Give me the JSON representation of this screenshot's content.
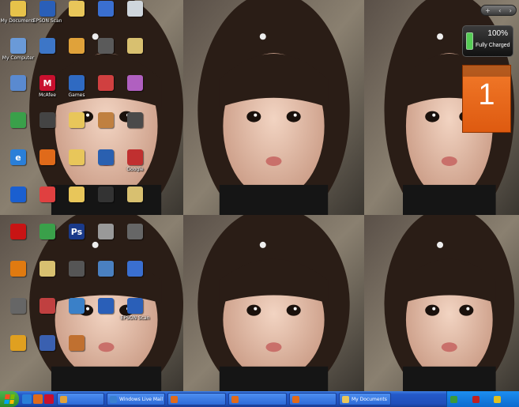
{
  "desktop": {
    "icons": [
      {
        "name": "my-documents-icon",
        "label": "My Documents",
        "glyph": "",
        "color": "#e7c24a"
      },
      {
        "name": "epson-scan-icon",
        "label": "EPSON Scan",
        "glyph": "",
        "color": "#2a5fb8"
      },
      {
        "name": "folder-icon",
        "label": "",
        "glyph": "",
        "color": "#e8c65a"
      },
      {
        "name": "app-icon",
        "label": "",
        "glyph": "",
        "color": "#3a6fd0"
      },
      {
        "name": "recycle-bin-icon",
        "label": "",
        "glyph": "",
        "color": "#cfd6dc"
      },
      {
        "name": "my-computer-icon",
        "label": "My Computer",
        "glyph": "",
        "color": "#6a9ad8"
      },
      {
        "name": "app-icon",
        "label": "",
        "glyph": "",
        "color": "#3d76c7"
      },
      {
        "name": "app-icon",
        "label": "",
        "glyph": "",
        "color": "#e0a23a"
      },
      {
        "name": "app-icon",
        "label": "",
        "glyph": "",
        "color": "#5a5a5a"
      },
      {
        "name": "app-icon",
        "label": "",
        "glyph": "",
        "color": "#d8c070"
      },
      {
        "name": "my-network-icon",
        "label": "",
        "glyph": "",
        "color": "#5a8ad0"
      },
      {
        "name": "mcafee-icon",
        "label": "McAfee",
        "glyph": "M",
        "color": "#c8102e"
      },
      {
        "name": "app-icon",
        "label": "Games",
        "glyph": "",
        "color": "#2f6ac2"
      },
      {
        "name": "app-icon",
        "label": "",
        "glyph": "",
        "color": "#d04040"
      },
      {
        "name": "app-icon",
        "label": "",
        "glyph": "",
        "color": "#b060c0"
      },
      {
        "name": "app-icon",
        "label": "",
        "glyph": "",
        "color": "#3aa04a"
      },
      {
        "name": "app-icon",
        "label": "",
        "glyph": "",
        "color": "#444444"
      },
      {
        "name": "folder-icon",
        "label": "",
        "glyph": "",
        "color": "#e8c65a"
      },
      {
        "name": "app-icon",
        "label": "",
        "glyph": "",
        "color": "#c08040"
      },
      {
        "name": "app-icon",
        "label": "",
        "glyph": "",
        "color": "#4a4a4a"
      },
      {
        "name": "internet-explorer-icon",
        "label": "",
        "glyph": "e",
        "color": "#2a7fd8"
      },
      {
        "name": "firefox-icon",
        "label": "",
        "glyph": "",
        "color": "#e06a1a"
      },
      {
        "name": "folder-icon",
        "label": "",
        "glyph": "",
        "color": "#e8c65a"
      },
      {
        "name": "app-icon",
        "label": "",
        "glyph": "",
        "color": "#2a60b0"
      },
      {
        "name": "google-sketchup-icon",
        "label": "Google",
        "glyph": "",
        "color": "#c03030"
      },
      {
        "name": "bluetooth-icon",
        "label": "",
        "glyph": "",
        "color": "#1a5fd0"
      },
      {
        "name": "app-icon",
        "label": "",
        "glyph": "",
        "color": "#e04040"
      },
      {
        "name": "folder-icon",
        "label": "",
        "glyph": "",
        "color": "#e8c65a"
      },
      {
        "name": "app-icon",
        "label": "",
        "glyph": "",
        "color": "#333333"
      },
      {
        "name": "app-icon",
        "label": "",
        "glyph": "",
        "color": "#d8c070"
      },
      {
        "name": "adobe-reader-icon",
        "label": "",
        "glyph": "",
        "color": "#c81414"
      },
      {
        "name": "app-icon",
        "label": "",
        "glyph": "",
        "color": "#3aa04a"
      },
      {
        "name": "photoshop-icon",
        "label": "",
        "glyph": "Ps",
        "color": "#1a3a8a"
      },
      {
        "name": "app-icon",
        "label": "",
        "glyph": "",
        "color": "#999999"
      },
      {
        "name": "app-icon",
        "label": "",
        "glyph": "",
        "color": "#666666"
      },
      {
        "name": "app-icon",
        "label": "",
        "glyph": "",
        "color": "#e07a10"
      },
      {
        "name": "app-icon",
        "label": "",
        "glyph": "",
        "color": "#d8c070"
      },
      {
        "name": "app-icon",
        "label": "",
        "glyph": "",
        "color": "#555555"
      },
      {
        "name": "app-icon",
        "label": "",
        "glyph": "",
        "color": "#4a80c0"
      },
      {
        "name": "app-icon",
        "label": "",
        "glyph": "",
        "color": "#3a6fd0"
      },
      {
        "name": "app-icon",
        "label": "",
        "glyph": "",
        "color": "#666666"
      },
      {
        "name": "app-icon",
        "label": "",
        "glyph": "",
        "color": "#c04040"
      },
      {
        "name": "app-icon",
        "label": "",
        "glyph": "",
        "color": "#3a80c8"
      },
      {
        "name": "app-icon",
        "label": "",
        "glyph": "",
        "color": "#2a5fb8"
      },
      {
        "name": "epson-scan-2-icon",
        "label": "EPSON Scan",
        "glyph": "",
        "color": "#2a5fb8"
      },
      {
        "name": "app-icon",
        "label": "",
        "glyph": "",
        "color": "#e0a020"
      },
      {
        "name": "app-icon",
        "label": "",
        "glyph": "",
        "color": "#3a60b0"
      },
      {
        "name": "app-icon",
        "label": "",
        "glyph": "",
        "color": "#c07030"
      }
    ]
  },
  "gadgets": {
    "battery": {
      "percent": "100%",
      "status": "Fully Charged"
    },
    "calendar": {
      "header": "",
      "day": "1",
      "weekday": ""
    }
  },
  "taskbar": {
    "tasks": [
      {
        "label": "",
        "color": "#e0a23a"
      },
      {
        "label": "Windows Live Mail",
        "color": "#3a80d0"
      },
      {
        "label": "",
        "color": "#e06a1a"
      },
      {
        "label": "",
        "color": "#e06a1a"
      },
      {
        "label": "",
        "color": "#e06a1a"
      },
      {
        "label": "My Documents",
        "color": "#e8c65a"
      }
    ],
    "clock": ""
  },
  "colors": {
    "taskbar": "#2459c9",
    "start": "#2a8a2a",
    "calendar": "#de5a10"
  }
}
